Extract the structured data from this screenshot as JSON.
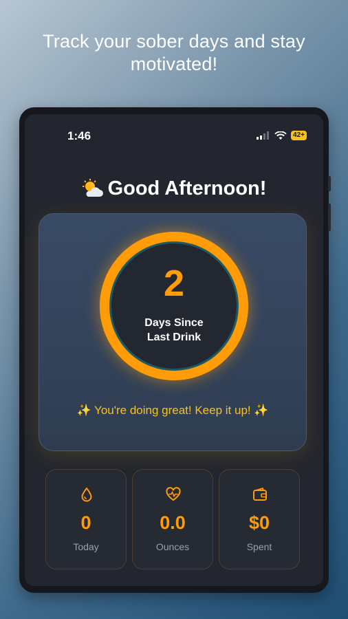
{
  "headline": "Track your sober days and stay motivated!",
  "status_bar": {
    "time": "1:46",
    "battery": "42+"
  },
  "greeting": {
    "icon": "partly-sunny-icon",
    "text": "Good Afternoon!"
  },
  "counter": {
    "days": "2",
    "label": "Days Since Last Drink"
  },
  "encouragement": "✨  You're doing great! Keep it up! ✨",
  "stats": [
    {
      "icon": "drop-icon",
      "value": "0",
      "label": "Today"
    },
    {
      "icon": "heart-pulse-icon",
      "value": "0.0",
      "label": "Ounces"
    },
    {
      "icon": "wallet-icon",
      "value": "$0",
      "label": "Spent"
    }
  ],
  "colors": {
    "accent": "#ff9c07",
    "gold": "#f7c21c",
    "card": "#394a64",
    "screen": "#23262e"
  }
}
